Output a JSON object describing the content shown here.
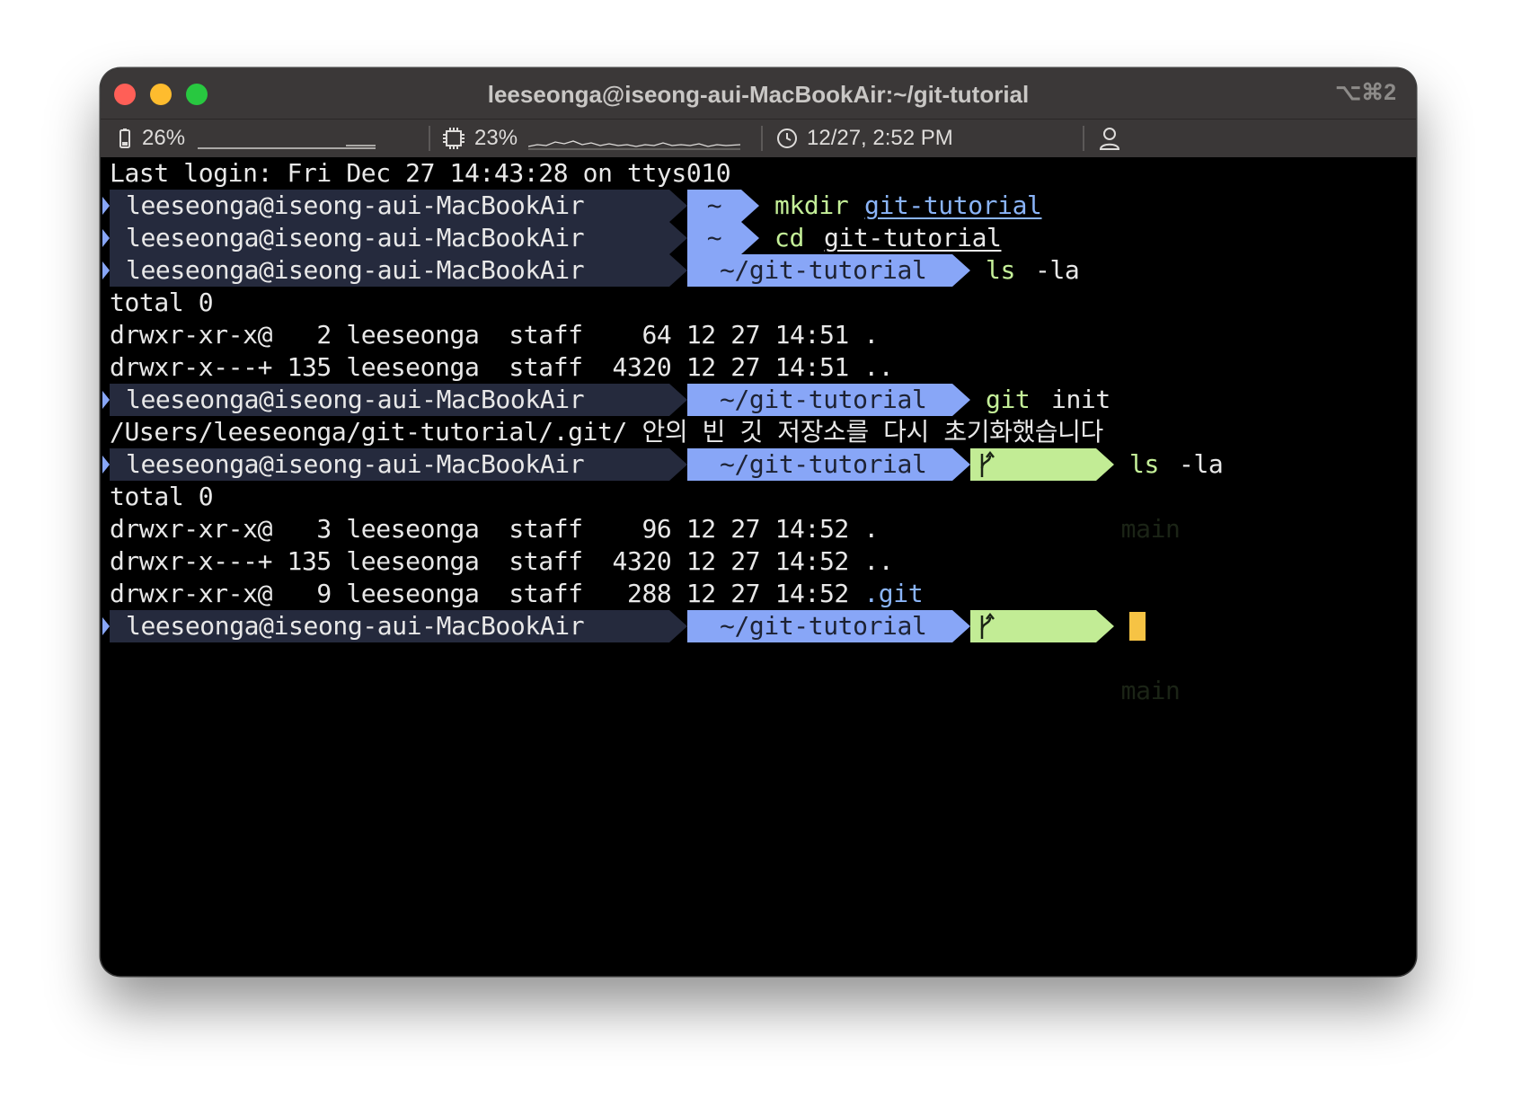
{
  "window": {
    "title": "leeseonga@iseong-aui-MacBookAir:~/git-tutorial",
    "shortcut": "⌥⌘2"
  },
  "status": {
    "battery": "26%",
    "cpu": "23%",
    "datetime": "12/27, 2:52 PM"
  },
  "prompt": {
    "user": "leeseonga@iseong-aui-MacBookAir",
    "home": "~",
    "path": "~/git-tutorial",
    "branch": "main"
  },
  "lines": {
    "login": "Last login: Fri Dec 27 14:43:28 on ttys010",
    "cmd1": "mkdir",
    "cmd1_arg": "git-tutorial",
    "cmd2": "cd",
    "cmd2_arg": "git-tutorial",
    "cmd3": "ls",
    "cmd3_arg": "-la",
    "total1": "total 0",
    "ls1_row1": "drwxr-xr-x@   2 leeseonga  staff    64 12 27 14:51 .",
    "ls1_row2": "drwxr-x---+ 135 leeseonga  staff  4320 12 27 14:51 ..",
    "cmd4": "git",
    "cmd4_arg": "init",
    "init_out": "/Users/leeseonga/git-tutorial/.git/ 안의 빈 깃 저장소를 다시 초기화했습니다",
    "cmd5": "ls",
    "cmd5_arg": "-la",
    "total2": "total 0",
    "ls2_row1": "drwxr-xr-x@   3 leeseonga  staff    96 12 27 14:52 .",
    "ls2_row2": "drwxr-x---+ 135 leeseonga  staff  4320 12 27 14:52 ..",
    "ls2_row3_pre": "drwxr-xr-x@   9 leeseonga  staff   288 12 27 14:52 ",
    "ls2_row3_name": ".git"
  }
}
